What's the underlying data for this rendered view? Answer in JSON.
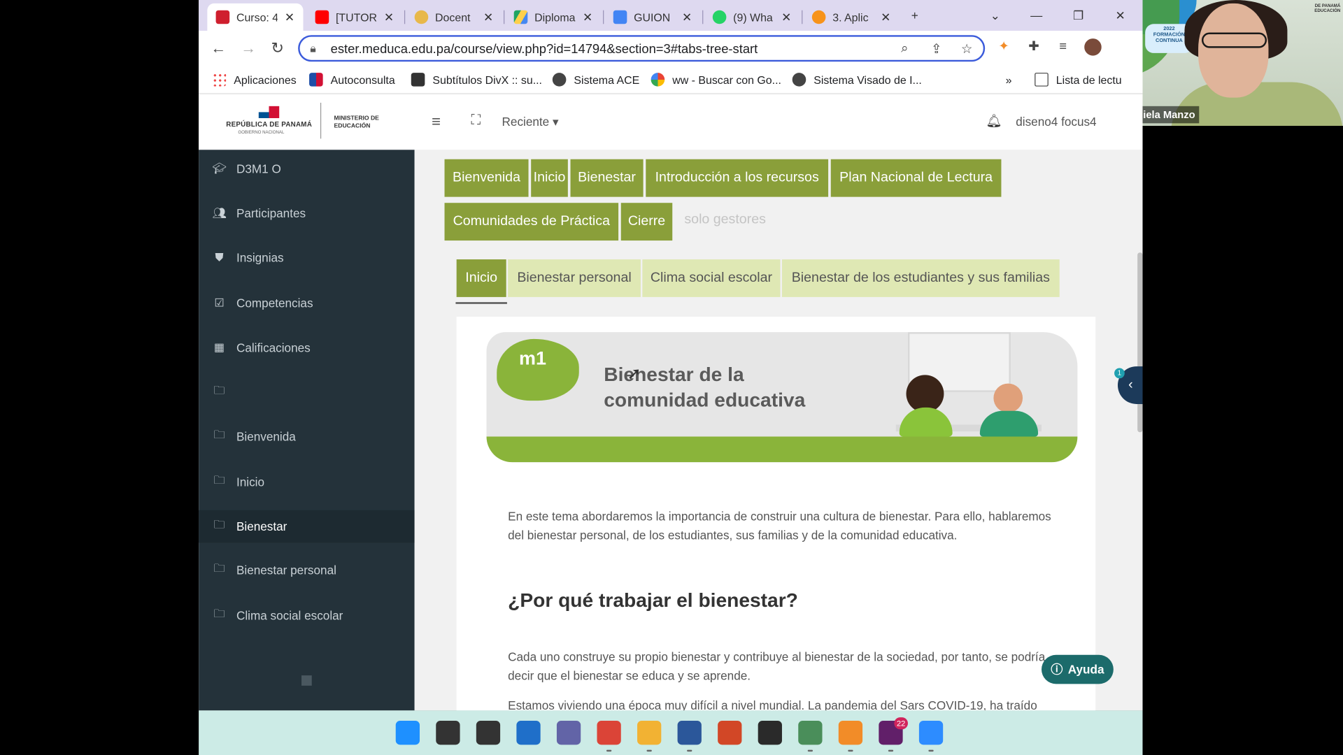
{
  "browser": {
    "tabs": [
      {
        "label": "Curso: 4",
        "icon": "meduca-favicon",
        "color": "#cf1f2e",
        "active": true
      },
      {
        "label": "[TUTOR",
        "icon": "youtube-favicon",
        "color": "#ff0000"
      },
      {
        "label": "Docent",
        "icon": "docente-favicon",
        "color": "#e8b84a"
      },
      {
        "label": "Diploma",
        "icon": "drive-favicon",
        "color": "#1fa463"
      },
      {
        "label": "GUION",
        "icon": "docs-favicon",
        "color": "#4285f4"
      },
      {
        "label": "(9) Wha",
        "icon": "whatsapp-favicon",
        "color": "#25d366"
      },
      {
        "label": "3. Aplic",
        "icon": "bitcoin-favicon",
        "color": "#f7931a"
      }
    ],
    "new_tab": "+",
    "url": "ester.meduca.edu.pa/course/view.php?id=14794&section=3#tabs-tree-start",
    "bookmarks": [
      {
        "label": "Aplicaciones",
        "icon": "apps-grid-icon"
      },
      {
        "label": "Autoconsulta",
        "icon": "autoconsulta-favicon"
      },
      {
        "label": "Subtítulos DivX :: su...",
        "icon": "subtitulos-favicon"
      },
      {
        "label": "Sistema ACE",
        "icon": "globe-icon"
      },
      {
        "label": "ww - Buscar con Go...",
        "icon": "google-favicon"
      },
      {
        "label": "Sistema Visado de I...",
        "icon": "globe-icon"
      }
    ],
    "bookmarks_more": "»",
    "reading_list": "Lista de lectu"
  },
  "header": {
    "logo_republic": "REPÚBLICA DE PANAMÁ",
    "logo_gobierno": "GOBIERNO NACIONAL",
    "logo_ministry": "MINISTERIO DE EDUCACIÓN",
    "recent": "Reciente ▾",
    "username": "diseno4 focus4"
  },
  "sidebar": {
    "items": [
      {
        "label": "D3M1 O",
        "icon": "graduation-cap-icon"
      },
      {
        "label": "Participantes",
        "icon": "users-icon"
      },
      {
        "label": "Insignias",
        "icon": "shield-icon"
      },
      {
        "label": "Competencias",
        "icon": "check-square-icon"
      },
      {
        "label": "Calificaciones",
        "icon": "table-icon"
      },
      {
        "label": "",
        "icon": "folder-icon"
      },
      {
        "label": "Bienvenida",
        "icon": "folder-icon"
      },
      {
        "label": "Inicio",
        "icon": "folder-icon"
      },
      {
        "label": "Bienestar",
        "icon": "folder-icon",
        "active": true
      },
      {
        "label": "Bienestar personal",
        "icon": "folder-icon"
      },
      {
        "label": "Clima social escolar",
        "icon": "folder-icon"
      }
    ]
  },
  "topnav": {
    "row1": [
      "Bienvenida",
      "Inicio",
      "Bienestar",
      "Introducción a los recursos",
      "Plan Nacional de Lectura"
    ],
    "row2": [
      "Comunidades de Práctica",
      "Cierre"
    ],
    "muted": "solo gestores"
  },
  "subtabs": [
    "Inicio",
    "Bienestar personal",
    "Clima social escolar",
    "Bienestar de los estudiantes y sus familias"
  ],
  "banner": {
    "module": "m1",
    "title_line1": "Bienestar de la",
    "title_line2": "comunidad educativa"
  },
  "content": {
    "intro": "En este tema abordaremos la importancia de construir una cultura de bienestar. Para ello, hablaremos del bienestar personal, de los estudiantes, sus familias y de la comunidad educativa.",
    "heading": "¿Por qué trabajar el bienestar?",
    "para2": "Cada uno construye su propio bienestar y contribuye al bienestar de la sociedad, por tanto, se podría decir que el bienestar se educa y se aprende.",
    "para3": "Estamos viviendo una época muy difícil a nivel mundial. La pandemia del Sars COVID-19, ha traído"
  },
  "help": {
    "label": "Ayuda"
  },
  "drawer": {
    "badge": "1"
  },
  "video": {
    "name": "Daniela Manzo",
    "badge_year": "2022",
    "badge_text": "FORMACIÓN CONTINUA",
    "corner": "DE PANAMÁ EDUCACIÓN"
  },
  "taskbar": {
    "apps": [
      {
        "name": "windows-start-icon",
        "color": "#1e90ff"
      },
      {
        "name": "search-icon",
        "color": "#333333"
      },
      {
        "name": "task-view-icon",
        "color": "#333333"
      },
      {
        "name": "widgets-icon",
        "color": "#1f6fc9"
      },
      {
        "name": "teams-chat-icon",
        "color": "#6264a7"
      },
      {
        "name": "chrome-icon",
        "color": "#db4437"
      },
      {
        "name": "file-explorer-icon",
        "color": "#f2b233"
      },
      {
        "name": "word-icon",
        "color": "#2b579a"
      },
      {
        "name": "powerpoint-icon",
        "color": "#d24726"
      },
      {
        "name": "sticky-notes-icon",
        "color": "#2a2a2a"
      },
      {
        "name": "chrome-profile-icon",
        "color": "#4a8e5a"
      },
      {
        "name": "app-orange-icon",
        "color": "#f28c28"
      },
      {
        "name": "slack-icon",
        "color": "#611f69"
      },
      {
        "name": "zoom-icon",
        "color": "#2d8cff"
      }
    ],
    "slack_badge": "22"
  }
}
